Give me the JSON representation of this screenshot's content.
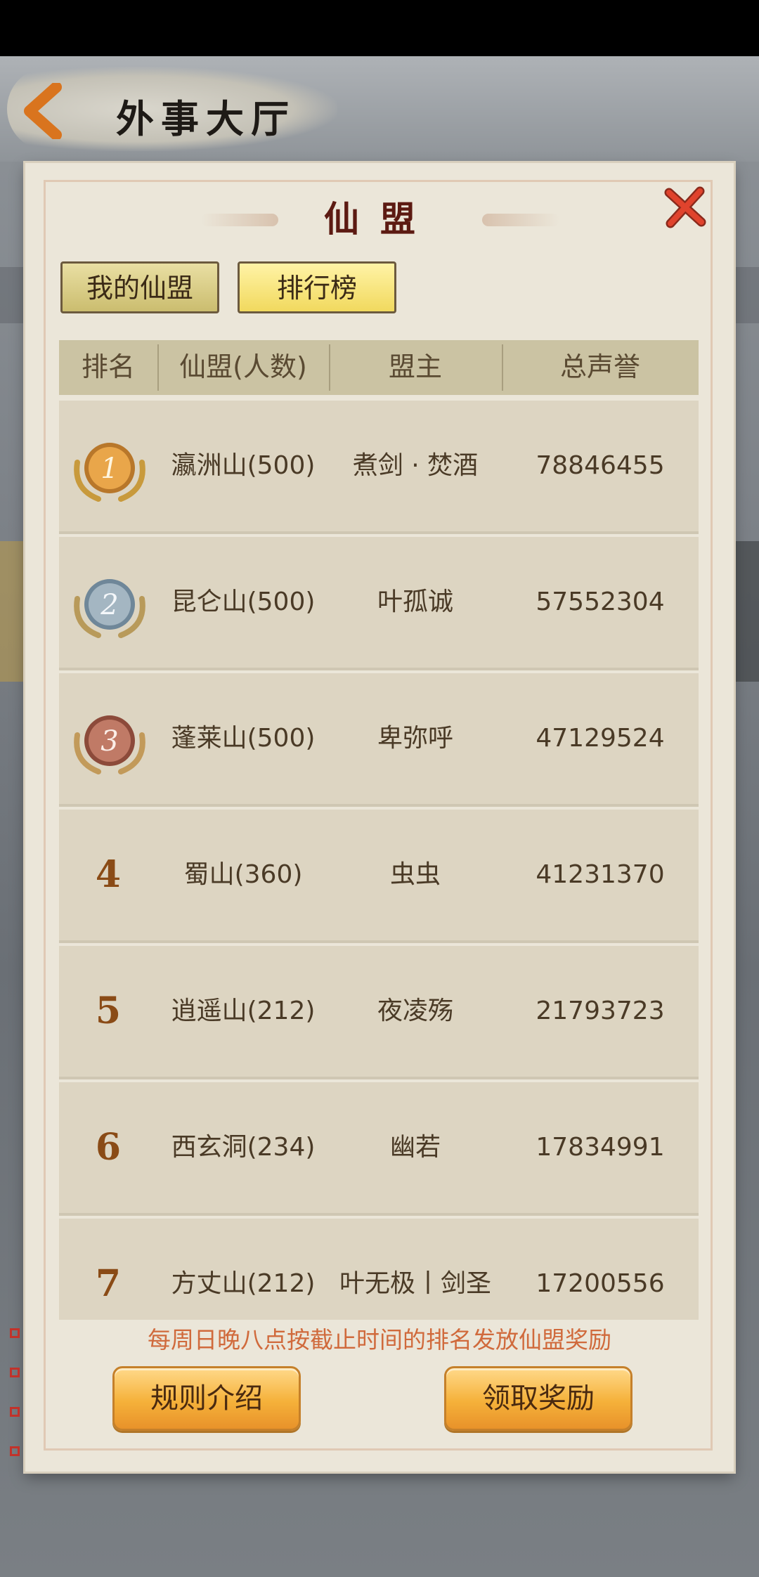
{
  "header": {
    "title": "外事大厅"
  },
  "modal": {
    "title": "仙盟",
    "tabs": [
      {
        "label": "我的仙盟",
        "active": false
      },
      {
        "label": "排行榜",
        "active": true
      }
    ],
    "table": {
      "columns": [
        "排名",
        "仙盟(人数)",
        "盟主",
        "总声誉"
      ],
      "rows": [
        {
          "rank": "1",
          "medal": "gold-medal-icon",
          "alliance": "瀛洲山(500)",
          "leader": "煮剑 · 焚酒",
          "reputation": "78846455"
        },
        {
          "rank": "2",
          "medal": "silver-medal-icon",
          "alliance": "昆仑山(500)",
          "leader": "叶孤诚",
          "reputation": "57552304"
        },
        {
          "rank": "3",
          "medal": "bronze-medal-icon",
          "alliance": "蓬莱山(500)",
          "leader": "卑弥呼",
          "reputation": "47129524"
        },
        {
          "rank": "4",
          "alliance": "蜀山(360)",
          "leader": "虫虫",
          "reputation": "41231370"
        },
        {
          "rank": "5",
          "alliance": "逍遥山(212)",
          "leader": "夜凌殇",
          "reputation": "21793723"
        },
        {
          "rank": "6",
          "alliance": "西玄洞(234)",
          "leader": "幽若",
          "reputation": "17834991"
        },
        {
          "rank": "7",
          "alliance": "方丈山(212)",
          "leader": "叶无极丨剑圣",
          "reputation": "17200556"
        }
      ]
    },
    "note": "每周日晚八点按截止时间的排名发放仙盟奖励",
    "buttons": {
      "rules": "规则介绍",
      "claim": "领取奖励"
    }
  },
  "colors": {
    "accent": "#f5b13a",
    "title": "#5c1a12",
    "close": "#d63a28",
    "note": "#d06a3c"
  }
}
